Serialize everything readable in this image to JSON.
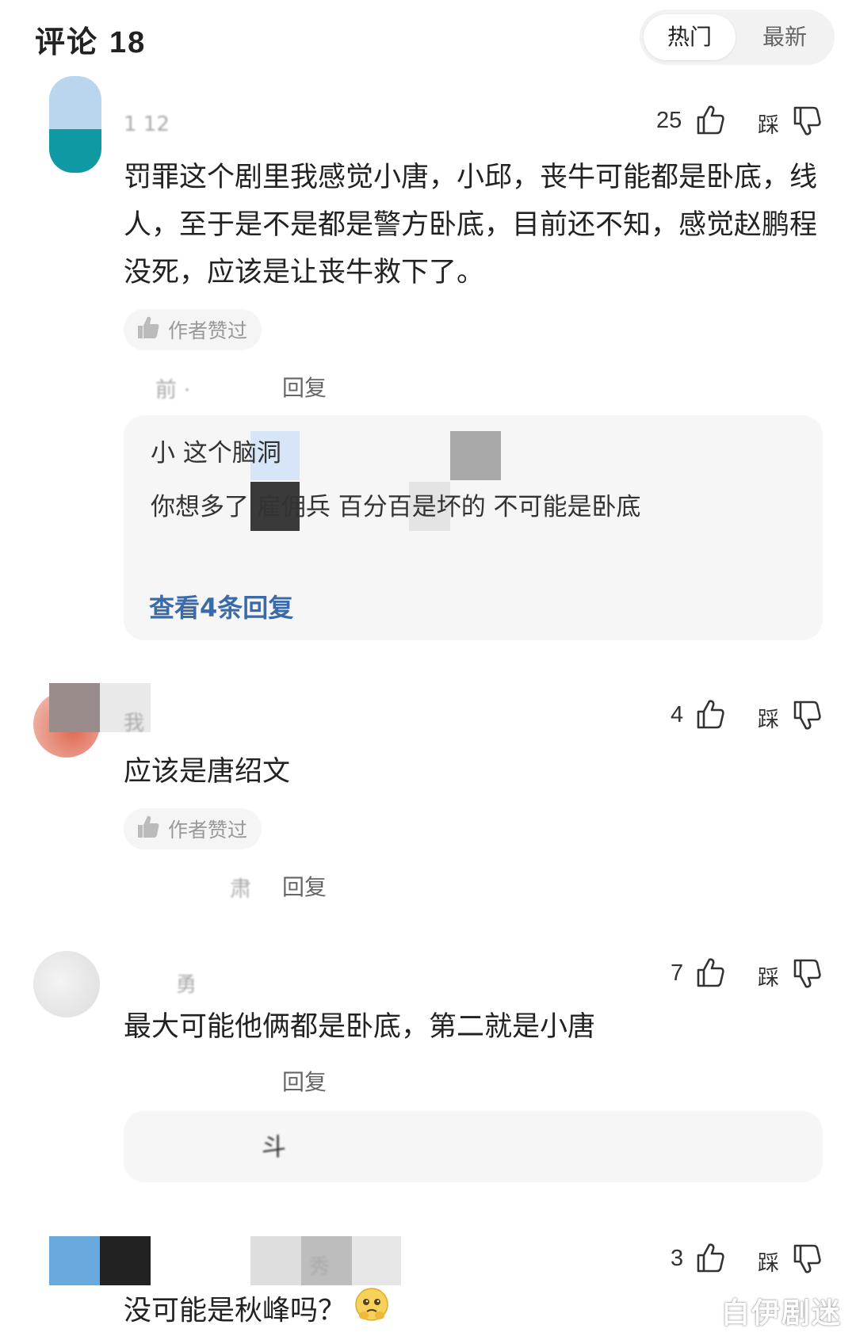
{
  "header": {
    "title": "评论",
    "count": "18",
    "tabs": [
      {
        "label": "热门",
        "active": true
      },
      {
        "label": "最新",
        "active": false
      }
    ]
  },
  "comments": [
    {
      "username": "1    12",
      "likes": "25",
      "tread_label": "踩",
      "text": "罚罪这个剧里我感觉小唐，小邱，丧牛可能都是卧底，线人，至于是不是都是警方卧底，目前还不知，感觉赵鹏程没死，应该是让丧牛救下了。",
      "author_liked": "作者赞过",
      "meta": "前 · ",
      "reply_label": "回复",
      "replies": [
        {
          "text": "小  这个脑洞"
        },
        {
          "text": "你想多了   雇佣兵 百分百是坏的 不可能是卧底"
        }
      ],
      "view_more": "查看4条回复"
    },
    {
      "username": "我  ",
      "likes": "4",
      "tread_label": "踩",
      "text": "应该是唐绍文",
      "author_liked": "作者赞过",
      "meta": "肃",
      "reply_label": "回复"
    },
    {
      "username": "勇",
      "likes": "7",
      "tread_label": "踩",
      "text": "最大可能他俩都是卧底，第二就是小唐",
      "meta": "",
      "reply_label": "回复",
      "replies": [
        {
          "text": "斗"
        }
      ]
    },
    {
      "username": "秀",
      "likes": "3",
      "tread_label": "踩",
      "text": "没可能是秋峰吗？"
    }
  ],
  "watermark": "白伊剧迷",
  "colors": {
    "link": "#3a6aa8",
    "background": "#ffffff",
    "reply_box": "#f6f6f6"
  },
  "icons": {
    "like": "thumbs-up-icon",
    "tread": "thumbs-down-icon",
    "author_liked": "thumbs-up-filled-icon"
  }
}
